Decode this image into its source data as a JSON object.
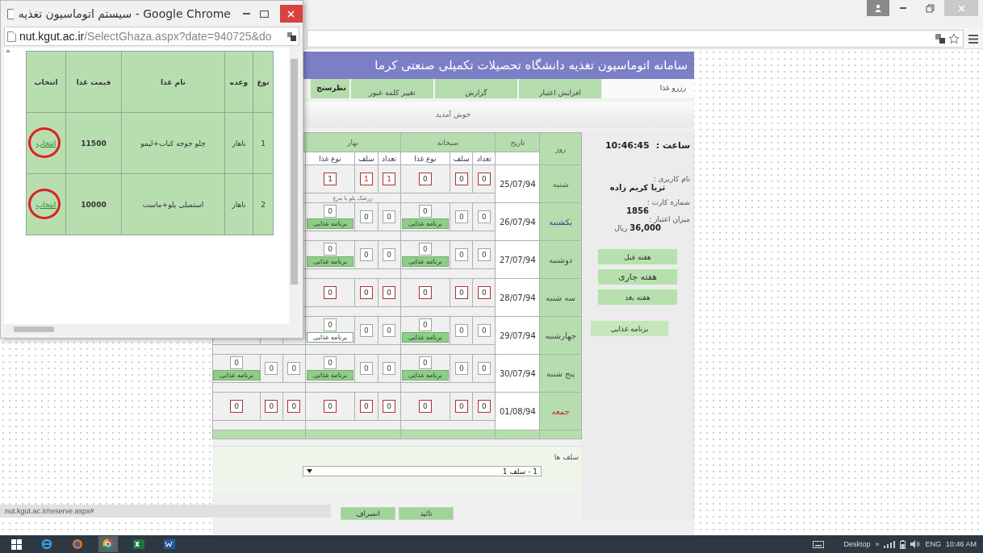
{
  "popup": {
    "title": "سیستم اتوماسیون تغذیه - Google Chrome",
    "url_host": "nut.kgut.ac.ir",
    "url_path": "/SelectGhaza.aspx?date=940725&do",
    "columns": [
      "نوع",
      "وعده",
      "نام غذا",
      "قیمت غذا",
      "انتخاب"
    ],
    "rows": [
      {
        "number": "1",
        "meal": "ناهار",
        "food": "چلو جوجه کباب+لیمو",
        "price": "11500",
        "action": "انتخاب",
        "circled": true
      },
      {
        "number": "2",
        "meal": "ناهار",
        "food": "استمبلی پلو+ماست",
        "price": "10000",
        "action": "انتخاب",
        "circled": true
      }
    ]
  },
  "page": {
    "banner": "سامانه اتوماسیون تغذیه دانشگاه تحصیلات تکمیلی صنعتی کرما",
    "menu": [
      {
        "label": "رزرو غذا",
        "selected": true
      },
      {
        "label": "افزایش اعتبار",
        "selected": false
      },
      {
        "label": "گزارش",
        "selected": false
      },
      {
        "label": "تغییر کلمه عبور",
        "selected": false
      },
      {
        "label": "نظرسنج",
        "selected": false
      }
    ],
    "welcome": "خوش آمدید",
    "table": {
      "day_header": "روز",
      "date_header": "تاریخ",
      "meals": [
        {
          "name": "صبحانه",
          "columns": [
            "تعداد",
            "سلف",
            "نوع غذا"
          ]
        },
        {
          "name": "نهار",
          "columns": [
            "تعداد",
            "سلف",
            "نوع غذا"
          ]
        }
      ],
      "rows": [
        {
          "day": "شنبه",
          "date": "25/07/94",
          "color": "#555555",
          "meals": [
            {
              "cells": [
                {
                  "kind": "locked",
                  "value": "0",
                  "changed": false
                },
                {
                  "kind": "locked",
                  "value": "0",
                  "changed": false
                },
                {
                  "kind": "locked",
                  "value": "0",
                  "changed": false
                }
              ]
            },
            {
              "cells": [
                {
                  "kind": "locked",
                  "value": "1",
                  "changed": true
                },
                {
                  "kind": "locked",
                  "value": "1",
                  "changed": true
                },
                {
                  "kind": "locked",
                  "value": "1",
                  "changed": false
                }
              ],
              "note": "زرشک پلو با مرغ"
            }
          ]
        },
        {
          "day": "یکشنبه",
          "date": "26/07/94",
          "color": "#333399",
          "meals": [
            {
              "cells": [
                {
                  "kind": "open",
                  "value": "0",
                  "changed": false
                },
                {
                  "kind": "open",
                  "value": "0",
                  "changed": false
                },
                {
                  "kind": "menu",
                  "value": "0",
                  "button": "برنامه غذایی",
                  "filled": true,
                  "changed": false
                }
              ]
            },
            {
              "cells": [
                {
                  "kind": "open",
                  "value": "0",
                  "changed": false
                },
                {
                  "kind": "open",
                  "value": "0",
                  "changed": false
                },
                {
                  "kind": "menu",
                  "value": "0",
                  "button": "برنامه غذایی",
                  "filled": true,
                  "changed": false
                }
              ]
            }
          ]
        },
        {
          "day": "دوشنبه",
          "date": "27/07/94",
          "color": "#444444",
          "meals": [
            {
              "cells": [
                {
                  "kind": "open",
                  "value": "0",
                  "changed": false
                },
                {
                  "kind": "open",
                  "value": "0",
                  "changed": false
                },
                {
                  "kind": "menu",
                  "value": "0",
                  "button": "برنامه غذایی",
                  "filled": true,
                  "changed": false
                }
              ]
            },
            {
              "cells": [
                {
                  "kind": "open",
                  "value": "0",
                  "changed": false
                },
                {
                  "kind": "open",
                  "value": "0",
                  "changed": false
                },
                {
                  "kind": "menu",
                  "value": "0",
                  "button": "برنامه غذایی",
                  "filled": true,
                  "changed": false
                }
              ]
            }
          ]
        },
        {
          "day": "سه شنبه",
          "date": "28/07/94",
          "color": "#444444",
          "meals": [
            {
              "cells": [
                {
                  "kind": "locked",
                  "value": "0",
                  "changed": false
                },
                {
                  "kind": "locked",
                  "value": "0",
                  "changed": false
                },
                {
                  "kind": "locked",
                  "value": "0",
                  "changed": false
                }
              ]
            },
            {
              "cells": [
                {
                  "kind": "locked",
                  "value": "0",
                  "changed": false
                },
                {
                  "kind": "locked",
                  "value": "0",
                  "changed": false
                },
                {
                  "kind": "locked",
                  "value": "0",
                  "changed": false
                }
              ]
            }
          ]
        },
        {
          "day": "جهارشنبه",
          "date": "29/07/94",
          "color": "#444444",
          "meals": [
            {
              "cells": [
                {
                  "kind": "open",
                  "value": "0",
                  "changed": false
                },
                {
                  "kind": "open",
                  "value": "0",
                  "changed": false
                },
                {
                  "kind": "menu",
                  "value": "0",
                  "button": "برنامه غذایی",
                  "filled": true,
                  "changed": false
                }
              ]
            },
            {
              "cells": [
                {
                  "kind": "open",
                  "value": "0",
                  "changed": false
                },
                {
                  "kind": "open",
                  "value": "0",
                  "changed": false
                },
                {
                  "kind": "menu",
                  "value": "0",
                  "button": "برنامه غذایی",
                  "filled": false,
                  "changed": false
                }
              ]
            }
          ]
        },
        {
          "day": "پنج شنبه",
          "date": "30/07/94",
          "color": "#444444",
          "meals": [
            {
              "cells": [
                {
                  "kind": "open",
                  "value": "0",
                  "changed": false
                },
                {
                  "kind": "open",
                  "value": "0",
                  "changed": false
                },
                {
                  "kind": "menu",
                  "value": "0",
                  "button": "برنامه غذایی",
                  "filled": true,
                  "changed": false
                }
              ]
            },
            {
              "cells": [
                {
                  "kind": "open",
                  "value": "0",
                  "changed": false
                },
                {
                  "kind": "open",
                  "value": "0",
                  "changed": false
                },
                {
                  "kind": "menu",
                  "value": "0",
                  "button": "برنامه غذایی",
                  "filled": true,
                  "changed": false
                }
              ]
            },
            {
              "cells": [
                {
                  "kind": "open",
                  "value": "0",
                  "changed": false
                },
                {
                  "kind": "open",
                  "value": "0",
                  "changed": false
                },
                {
                  "kind": "menu",
                  "value": "0",
                  "button": "برنامه غذایی",
                  "filled": true,
                  "changed": false
                }
              ]
            }
          ]
        },
        {
          "day": "جمعه",
          "date": "01/08/94",
          "color": "#cc2222",
          "meals": [
            {
              "cells": [
                {
                  "kind": "locked",
                  "value": "0",
                  "changed": false
                },
                {
                  "kind": "locked",
                  "value": "0",
                  "changed": false
                },
                {
                  "kind": "locked",
                  "value": "0",
                  "changed": false
                }
              ]
            },
            {
              "cells": [
                {
                  "kind": "locked",
                  "value": "0",
                  "changed": false
                },
                {
                  "kind": "locked",
                  "value": "0",
                  "changed": false
                },
                {
                  "kind": "locked",
                  "value": "0",
                  "changed": false
                }
              ]
            },
            {
              "cells": [
                {
                  "kind": "locked",
                  "value": "0",
                  "changed": false
                },
                {
                  "kind": "locked",
                  "value": "0",
                  "changed": false
                },
                {
                  "kind": "locked",
                  "value": "0",
                  "changed": false
                }
              ]
            }
          ]
        }
      ]
    },
    "sidebar": {
      "clock_label": "ساعت :",
      "clock": "10:46:45",
      "user_label": "نام کاربری :",
      "user": "ثریا کریم زاده",
      "card_label": "شماره کارت :",
      "card": "1856",
      "credit_label": "میزان اعتبار :",
      "credit": "36,000",
      "currency": "ریال",
      "week_buttons": [
        "هفته قبل",
        "هفته جاری",
        "هفته بعد"
      ],
      "menu_button": "برنامه غذایی"
    },
    "footer": {
      "restaurants_label": "سلف ها",
      "restaurant": "1 - سلف 1",
      "buttons": [
        "تائید",
        "انصراف"
      ]
    }
  },
  "status_url": "nut.kgut.ac.ir/reserve.aspx#",
  "taskbar": {
    "desktop": "Desktop",
    "overflow": "»",
    "lang": "ENG",
    "time": "10:46 AM"
  }
}
